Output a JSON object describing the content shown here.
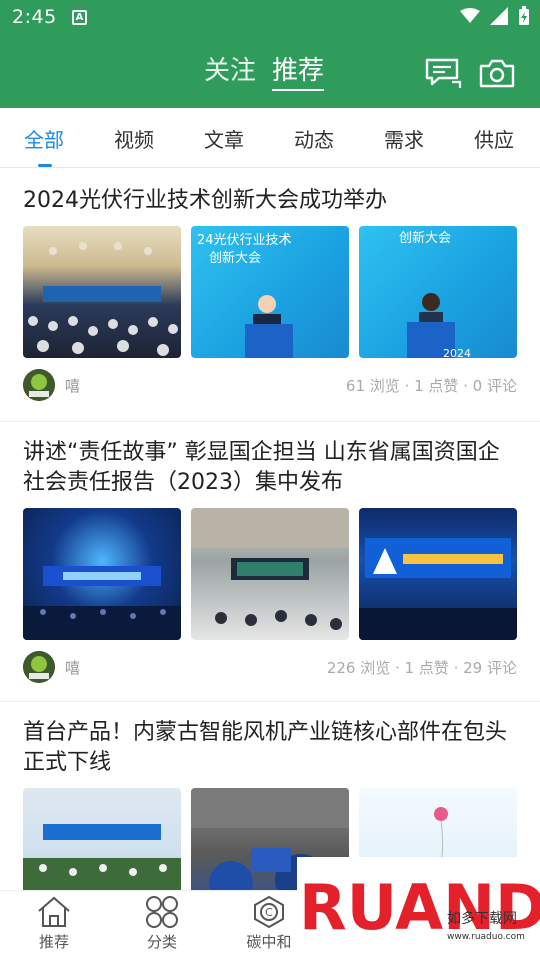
{
  "status": {
    "time": "2:45",
    "indicator": "A"
  },
  "header": {
    "follow": "关注",
    "recommend": "推荐"
  },
  "tabs": [
    "全部",
    "视频",
    "文章",
    "动态",
    "需求",
    "供应"
  ],
  "articles": [
    {
      "title": "2024光伏行业技术创新大会成功举办",
      "author": "嘻",
      "stats": "61 浏览 · 1 点赞 · 0 评论",
      "images": [
        "venue-audience",
        "speaker-male-stage",
        "speaker-female-stage"
      ],
      "image_text": {
        "b": "24光伏行业技术",
        "b2": "创新大会",
        "c": "创新大会",
        "c_year": "2024"
      }
    },
    {
      "title": "讲述“责任故事” 彰显国企担当 山东省属国资国企社会责任报告（2023）集中发布",
      "author": "嘻",
      "stats": "226 浏览 · 1 点赞 · 29 评论",
      "images": [
        "blue-stage-hall",
        "ornate-hall-audience",
        "stage-banner-closeup"
      ]
    },
    {
      "title": "首台产品！内蒙古智能风机产业链核心部件在包头正式下线",
      "author": "",
      "stats": "",
      "images": [
        "outdoor-ceremony",
        "factory-equipment",
        "balloons-sky"
      ]
    }
  ],
  "bottom_nav": [
    {
      "label": "推荐",
      "icon": "home-icon"
    },
    {
      "label": "分类",
      "icon": "grid-icon"
    },
    {
      "label": "碳中和",
      "icon": "carbon-icon"
    }
  ],
  "watermark": {
    "brand": "RUANDAO",
    "sub": "如多下载网",
    "url": "www.ruaduo.com"
  },
  "colors": {
    "brand_green": "#2f9c5c",
    "active_blue": "#1e88e5"
  }
}
